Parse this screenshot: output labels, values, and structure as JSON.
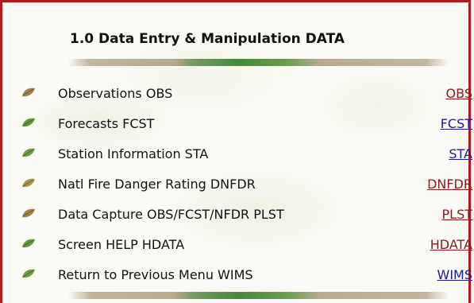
{
  "header": {
    "title": "1.0 Data Entry & Manipulation DATA"
  },
  "colors": {
    "border": "#b8141a",
    "link_visited": "#8b1a1a",
    "link_unvisited": "#1a1a9c",
    "leaf_brown": "#a0844a",
    "leaf_green": "#5f9a3a"
  },
  "menu": {
    "items": [
      {
        "label": "Observations OBS",
        "link": "OBS",
        "icon": "leaf-brown-icon",
        "link_color": "#8b1a1a"
      },
      {
        "label": "Forecasts FCST",
        "link": "FCST",
        "icon": "leaf-green-icon",
        "link_color": "#1a1a9c"
      },
      {
        "label": "Station Information STA",
        "link": "STA",
        "icon": "leaf-green-icon",
        "link_color": "#1a1a9c"
      },
      {
        "label": "Natl Fire Danger Rating DNFDR",
        "link": "DNFDR",
        "icon": "leaf-brown-icon",
        "link_color": "#8b1a1a"
      },
      {
        "label": "Data Capture OBS/FCST/NFDR PLST",
        "link": "PLST",
        "icon": "leaf-brown-icon",
        "link_color": "#8b1a1a"
      },
      {
        "label": "Screen HELP HDATA",
        "link": "HDATA",
        "icon": "leaf-green-icon",
        "link_color": "#8b1a1a"
      },
      {
        "label": "Return to Previous Menu WIMS",
        "link": "WIMS",
        "icon": "leaf-green-icon",
        "link_color": "#1a1a9c"
      }
    ]
  }
}
